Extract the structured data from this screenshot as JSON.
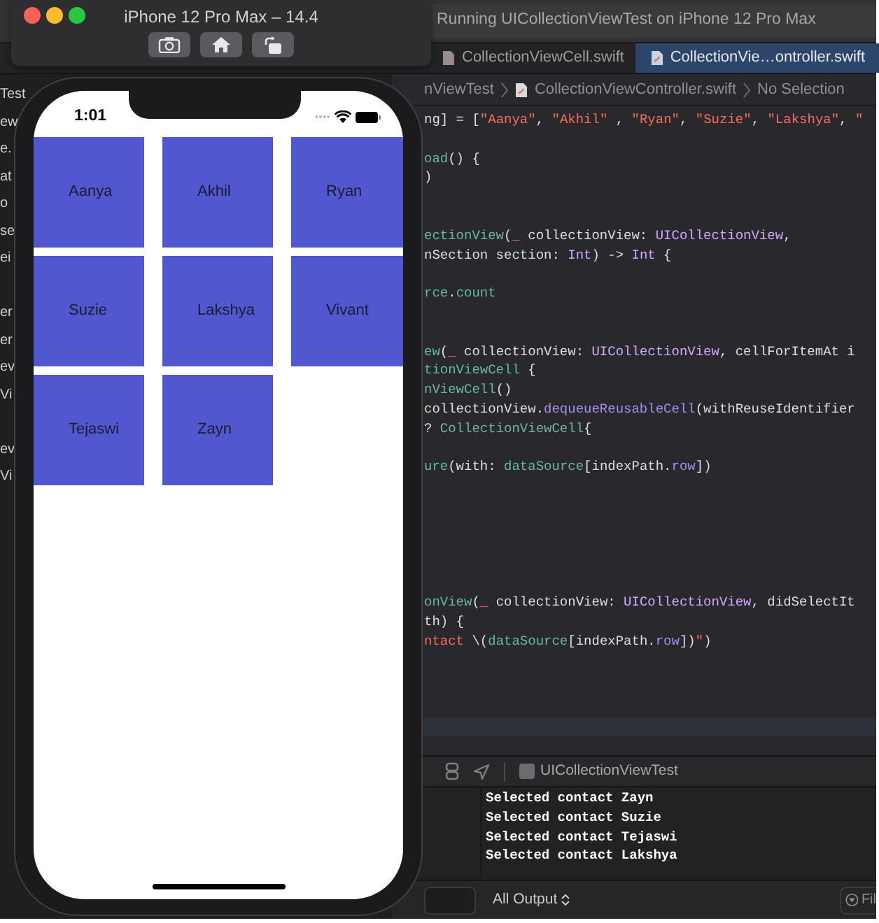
{
  "xcode": {
    "activity": "Running UICollectionViewTest on iPhone 12 Pro Max",
    "tabs": [
      {
        "label": "CollectionViewCell.swift",
        "selected": false
      },
      {
        "label": "CollectionVie…ontroller.swift",
        "selected": true
      }
    ],
    "navigator_fragments": [
      "Test",
      "ew",
      "e.",
      "at",
      "o",
      "se",
      "ei",
      "er",
      "er",
      "ev",
      "Vi",
      "ev",
      "Vi"
    ],
    "jump_bar": [
      "nViewTest",
      "CollectionViewController.swift",
      "No Selection"
    ],
    "code_lines": [
      {
        "segments": [
          {
            "kind": "plain",
            "text": "ng] = ["
          },
          {
            "kind": "str",
            "text": "\"Aanya\""
          },
          {
            "kind": "plain",
            "text": ", "
          },
          {
            "kind": "str",
            "text": "\"Akhil\""
          },
          {
            "kind": "plain",
            "text": " , "
          },
          {
            "kind": "str",
            "text": "\"Ryan\""
          },
          {
            "kind": "plain",
            "text": ", "
          },
          {
            "kind": "str",
            "text": "\"Suzie\""
          },
          {
            "kind": "plain",
            "text": ", "
          },
          {
            "kind": "str",
            "text": "\"Lakshya\""
          },
          {
            "kind": "plain",
            "text": ", "
          },
          {
            "kind": "str",
            "text": "\""
          }
        ]
      },
      {
        "segments": [
          {
            "kind": "fn",
            "text": "oad"
          },
          {
            "kind": "plain",
            "text": "() {"
          }
        ]
      },
      {
        "segments": [
          {
            "kind": "plain",
            "text": ")"
          }
        ]
      },
      {
        "segments": [
          {
            "kind": "fn",
            "text": "ectionView"
          },
          {
            "kind": "plain",
            "text": "("
          },
          {
            "kind": "str",
            "text": "_"
          },
          {
            "kind": "plain",
            "text": " collectionView: "
          },
          {
            "kind": "ty",
            "text": "UICollectionView"
          },
          {
            "kind": "plain",
            "text": ","
          }
        ]
      },
      {
        "segments": [
          {
            "kind": "plain",
            "text": "nSection section: "
          },
          {
            "kind": "ty",
            "text": "Int"
          },
          {
            "kind": "plain",
            "text": ") -> "
          },
          {
            "kind": "ty",
            "text": "Int"
          },
          {
            "kind": "plain",
            "text": " {"
          }
        ]
      },
      {
        "segments": [
          {
            "kind": "fn",
            "text": "rce"
          },
          {
            "kind": "plain",
            "text": "."
          },
          {
            "kind": "fn",
            "text": "count"
          }
        ]
      },
      {
        "segments": [
          {
            "kind": "fn",
            "text": "ew"
          },
          {
            "kind": "plain",
            "text": "("
          },
          {
            "kind": "str",
            "text": "_"
          },
          {
            "kind": "plain",
            "text": " collectionView: "
          },
          {
            "kind": "ty",
            "text": "UICollectionView"
          },
          {
            "kind": "plain",
            "text": ", cellForItemAt i"
          }
        ]
      },
      {
        "segments": [
          {
            "kind": "fn",
            "text": "tionViewCell"
          },
          {
            "kind": "plain",
            "text": " {"
          }
        ]
      },
      {
        "segments": [
          {
            "kind": "fn",
            "text": "nViewCell"
          },
          {
            "kind": "plain",
            "text": "()"
          }
        ]
      },
      {
        "segments": [
          {
            "kind": "plain",
            "text": "collectionView."
          },
          {
            "kind": "member",
            "text": "dequeueReusableCell"
          },
          {
            "kind": "plain",
            "text": "(withReuseIdentifier"
          }
        ]
      },
      {
        "segments": [
          {
            "kind": "plain",
            "text": "? "
          },
          {
            "kind": "fn",
            "text": "CollectionViewCell"
          },
          {
            "kind": "plain",
            "text": "{"
          }
        ]
      },
      {
        "segments": [
          {
            "kind": "fn",
            "text": "ure"
          },
          {
            "kind": "plain",
            "text": "(with: "
          },
          {
            "kind": "fn",
            "text": "dataSource"
          },
          {
            "kind": "plain",
            "text": "[indexPath."
          },
          {
            "kind": "member",
            "text": "row"
          },
          {
            "kind": "plain",
            "text": "])"
          }
        ]
      },
      {
        "segments": [
          {
            "kind": "fn",
            "text": "onView"
          },
          {
            "kind": "plain",
            "text": "("
          },
          {
            "kind": "str",
            "text": "_"
          },
          {
            "kind": "plain",
            "text": " collectionView: "
          },
          {
            "kind": "ty",
            "text": "UICollectionView"
          },
          {
            "kind": "plain",
            "text": ", didSelectIt"
          }
        ]
      },
      {
        "segments": [
          {
            "kind": "plain",
            "text": "th) {"
          }
        ]
      },
      {
        "segments": [
          {
            "kind": "str",
            "text": "ntact "
          },
          {
            "kind": "plain",
            "text": "\\("
          },
          {
            "kind": "fn",
            "text": "dataSource"
          },
          {
            "kind": "plain",
            "text": "[indexPath."
          },
          {
            "kind": "member",
            "text": "row"
          },
          {
            "kind": "plain",
            "text": "])"
          },
          {
            "kind": "str",
            "text": "\""
          },
          {
            "kind": "plain",
            "text": ")"
          }
        ]
      }
    ],
    "debug_bar": {
      "target": "UICollectionViewTest"
    },
    "console": {
      "lines": [
        "Selected contact Zayn",
        "Selected contact Suzie",
        "Selected contact Tejaswi",
        "Selected contact Lakshya"
      ],
      "output_menu": "All Output",
      "filter_placeholder": "Fil"
    }
  },
  "simulator": {
    "title": "iPhone 12 Pro Max – 14.4",
    "time": "1:01",
    "cells": [
      "Aanya",
      "Akhil",
      "Ryan",
      "Suzie",
      "Lakshya",
      "Vivant",
      "Tejaswi",
      "Zayn"
    ]
  }
}
